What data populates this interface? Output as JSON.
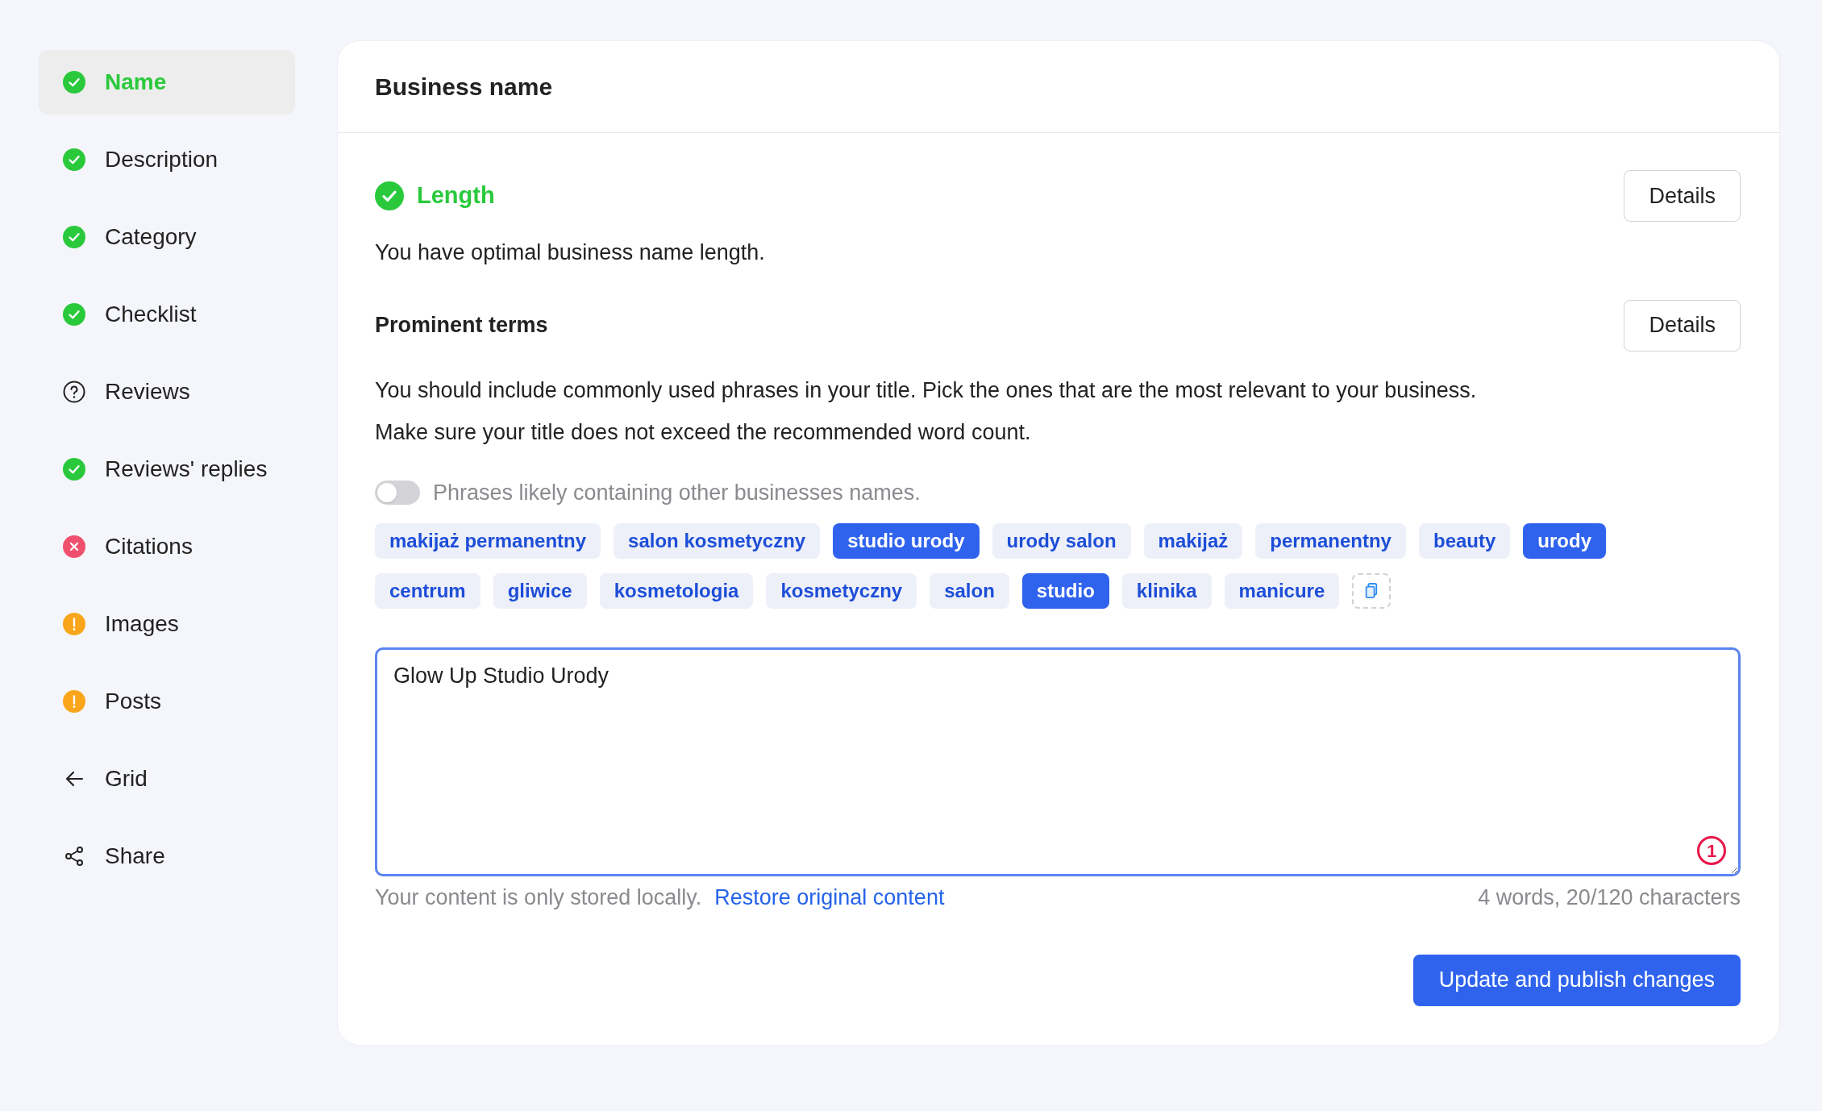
{
  "sidebar": {
    "items": [
      {
        "label": "Name",
        "kind": "ok",
        "selected": true
      },
      {
        "label": "Description",
        "kind": "ok",
        "selected": false
      },
      {
        "label": "Category",
        "kind": "ok",
        "selected": false
      },
      {
        "label": "Checklist",
        "kind": "ok",
        "selected": false
      },
      {
        "label": "Reviews",
        "kind": "unknown",
        "selected": false
      },
      {
        "label": "Reviews' replies",
        "kind": "ok",
        "selected": false
      },
      {
        "label": "Citations",
        "kind": "error",
        "selected": false
      },
      {
        "label": "Images",
        "kind": "warning",
        "selected": false
      },
      {
        "label": "Posts",
        "kind": "warning",
        "selected": false
      },
      {
        "label": "Grid",
        "kind": "back",
        "selected": false
      },
      {
        "label": "Share",
        "kind": "share",
        "selected": false
      }
    ]
  },
  "card": {
    "title": "Business name",
    "length": {
      "title": "Length",
      "passed": true,
      "button": "Details",
      "text": "You have optimal business name length."
    },
    "prominent_terms": {
      "title": "Prominent terms",
      "button": "Details",
      "lines": [
        "You should include commonly used phrases in your title. Pick the ones that are the most relevant to your business.",
        "Make sure your title does not exceed the recommended word count."
      ],
      "toggle": {
        "label": "Phrases likely containing other businesses names.",
        "on": false
      },
      "tags": [
        {
          "label": "makijaż permanentny",
          "selected": false
        },
        {
          "label": "salon kosmetyczny",
          "selected": false
        },
        {
          "label": "studio urody",
          "selected": true
        },
        {
          "label": "urody salon",
          "selected": false
        },
        {
          "label": "makijaż",
          "selected": false
        },
        {
          "label": "permanentny",
          "selected": false
        },
        {
          "label": "beauty",
          "selected": false
        },
        {
          "label": "urody",
          "selected": true
        },
        {
          "label": "centrum",
          "selected": false
        },
        {
          "label": "gliwice",
          "selected": false
        },
        {
          "label": "kosmetologia",
          "selected": false
        },
        {
          "label": "kosmetyczny",
          "selected": false
        },
        {
          "label": "salon",
          "selected": false
        },
        {
          "label": "studio",
          "selected": true
        },
        {
          "label": "klinika",
          "selected": false
        },
        {
          "label": "manicure",
          "selected": false
        }
      ]
    },
    "editor": {
      "value": "Glow Up Studio Urody",
      "issues_badge": "1",
      "note": "Your content is only stored locally.",
      "restore_link": "Restore original content",
      "counter": "4 words, 20/120 characters"
    },
    "submit_button": "Update and publish changes"
  }
}
